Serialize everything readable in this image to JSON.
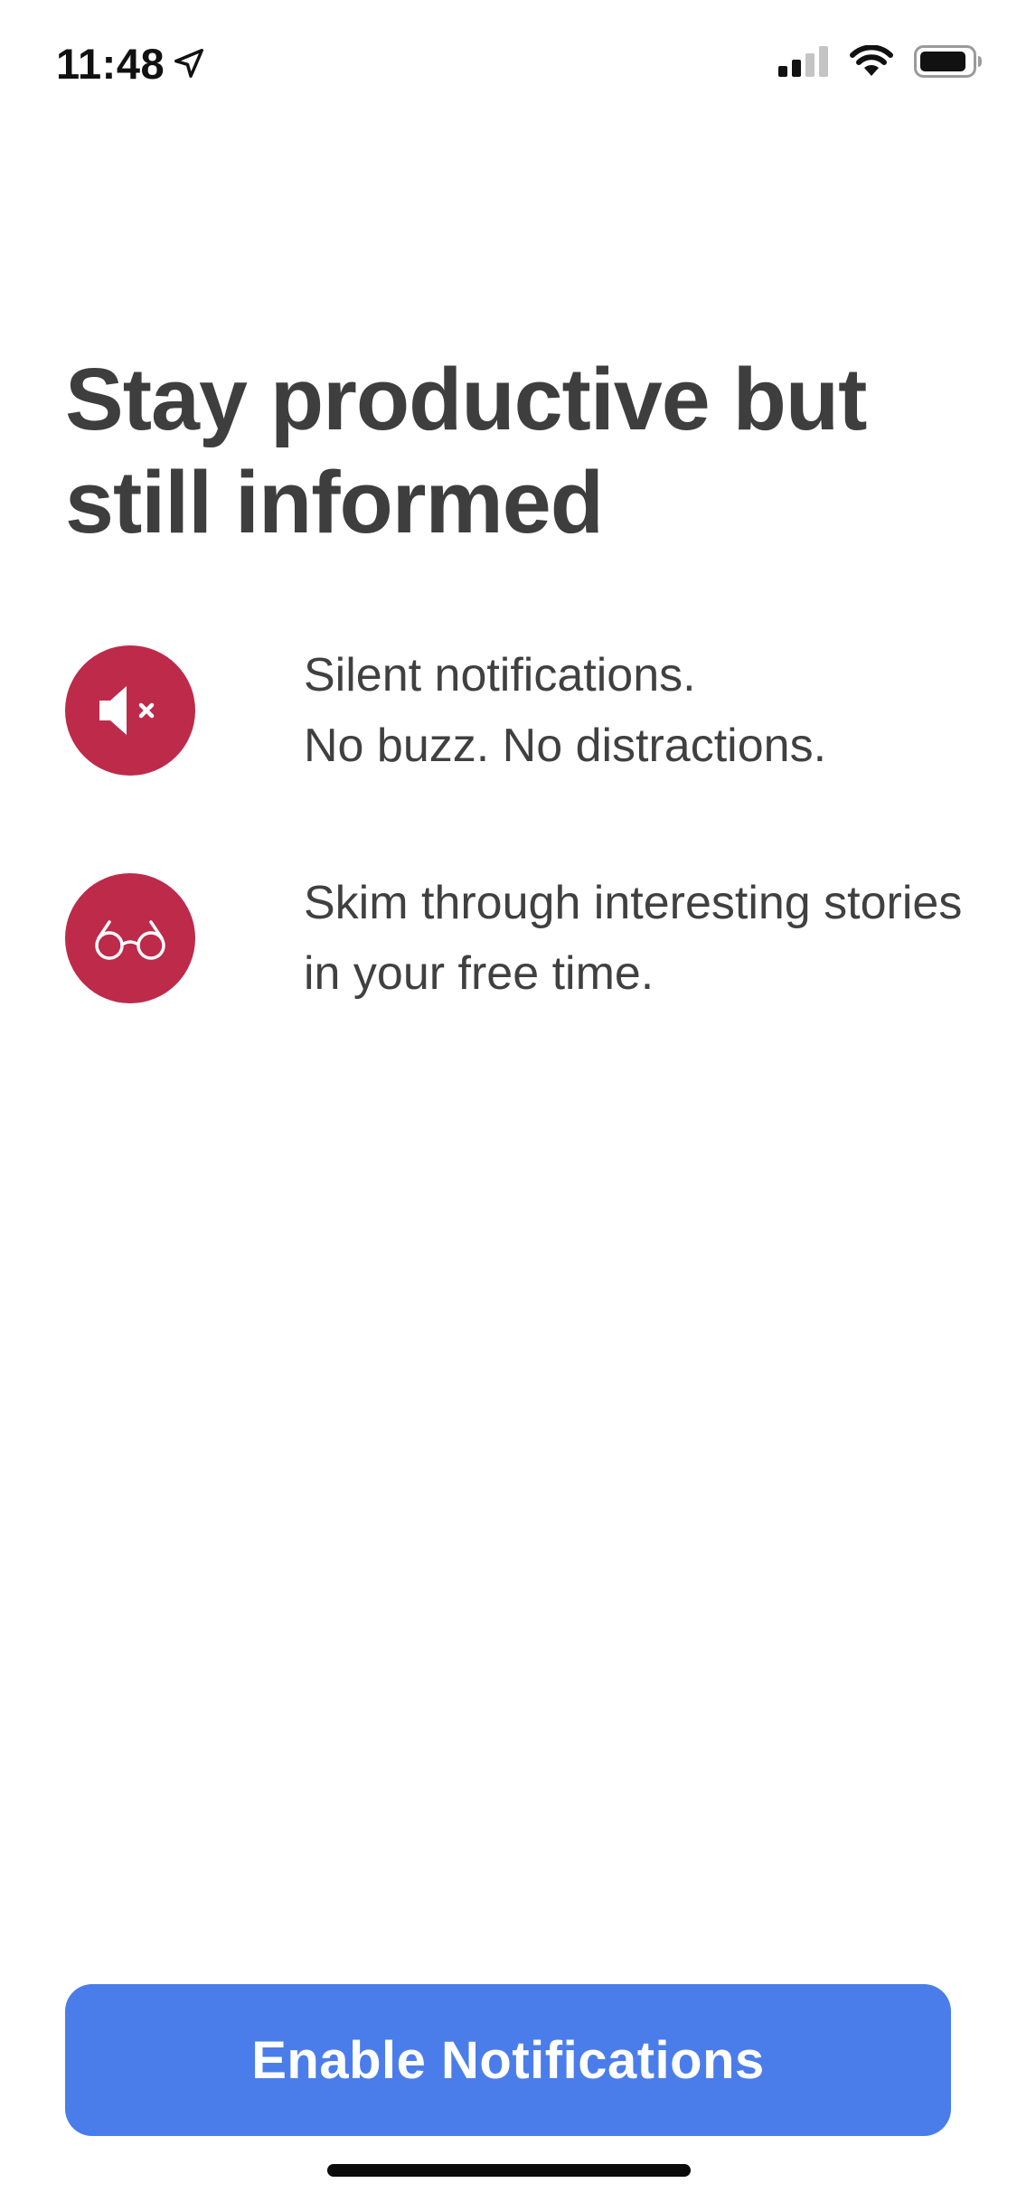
{
  "status_bar": {
    "time": "11:48",
    "location_icon": "location-arrow-icon",
    "signal_icon": "cellular-signal-icon",
    "wifi_icon": "wifi-icon",
    "battery_icon": "battery-icon"
  },
  "heading": "Stay productive but\nstill informed",
  "features": [
    {
      "icon": "speaker-muted-icon",
      "lines": [
        "Silent notifications.",
        "No buzz. No distractions."
      ]
    },
    {
      "icon": "glasses-icon",
      "lines": [
        "Skim through interesting stories",
        "in your free time."
      ]
    }
  ],
  "button": {
    "label": "Enable Notifications"
  },
  "colors": {
    "accent": "#4b7dea",
    "icon_background": "#be2a4a",
    "heading": "#3e3e3e",
    "body_text": "#404040"
  }
}
